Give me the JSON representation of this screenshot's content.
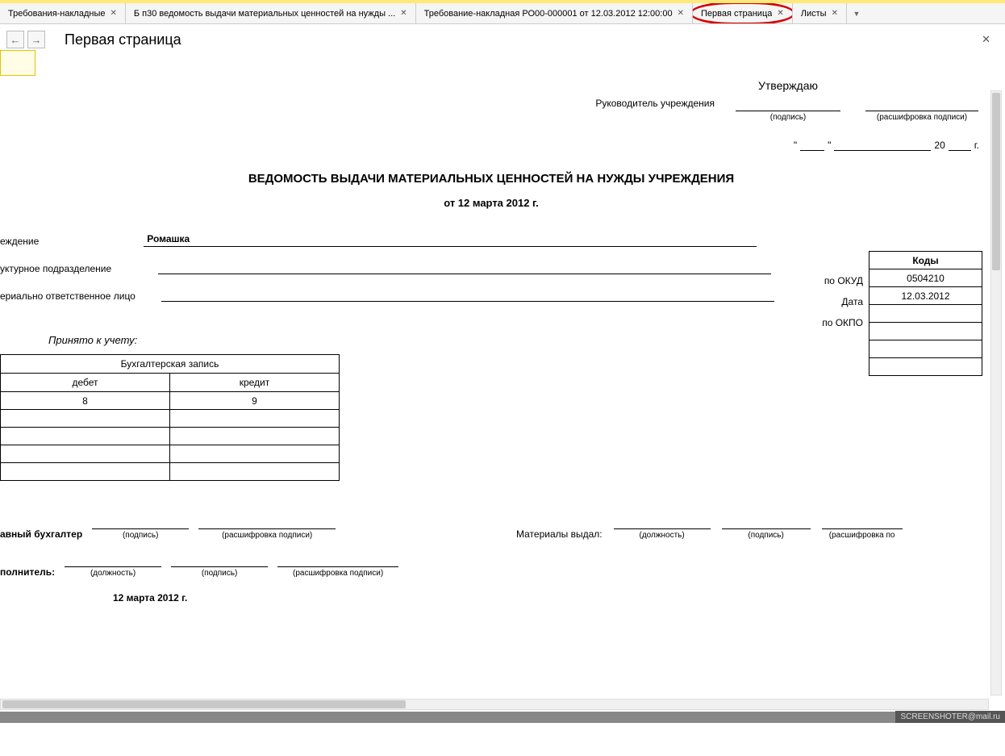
{
  "tabs": [
    {
      "label": "Требования-накладные"
    },
    {
      "label": "Б п30 ведомость выдачи материальных ценностей на нужды ..."
    },
    {
      "label": "Требование-накладная РО00-000001 от 12.03.2012 12:00:00"
    },
    {
      "label": "Первая страница"
    },
    {
      "label": "Листы"
    }
  ],
  "page_title": "Первая страница",
  "approve": {
    "leader_label": "Руководитель учреждения",
    "approve_word": "Утверждаю",
    "sign_caption": "(подпись)",
    "decipher_caption": "(расшифровка подписи)"
  },
  "date_tail": {
    "year_prefix": "20",
    "year_suffix": "г."
  },
  "header": {
    "title": "ВЕДОМОСТЬ ВЫДАЧИ МАТЕРИАЛЬНЫХ ЦЕННОСТЕЙ НА НУЖДЫ УЧРЕЖДЕНИЯ",
    "subtitle": "от 12 марта 2012 г."
  },
  "codes": {
    "header": "Коды",
    "okud_label": "по ОКУД",
    "okud_value": "0504210",
    "date_label": "Дата",
    "date_value": "12.03.2012",
    "okpo_label": "по ОКПО",
    "okpo_value": ""
  },
  "info": {
    "institution_label": "еждение",
    "institution_value": "Ромашка",
    "subdivision_label": "уктурное подразделение",
    "subdivision_value": "",
    "responsible_label": "ериально ответственное лицо",
    "responsible_value": ""
  },
  "accepted_label": "Принято к учету:",
  "acct": {
    "title": "Бухгалтерская запись",
    "debit": "дебет",
    "credit": "кредит",
    "debit_num": "8",
    "credit_num": "9"
  },
  "bottom": {
    "chief_acc": "авный бухгалтер",
    "executor": "полнитель:",
    "materials_issued": "Материалы выдал:",
    "position_cap": "(должность)",
    "sign_cap": "(подпись)",
    "decipher_cap": "(расшифровка подписи)",
    "decipher_cap_cut": "(расшифровка по",
    "date": "12 марта 2012 г."
  },
  "watermark": "SCREENSHOTER@mail.ru"
}
